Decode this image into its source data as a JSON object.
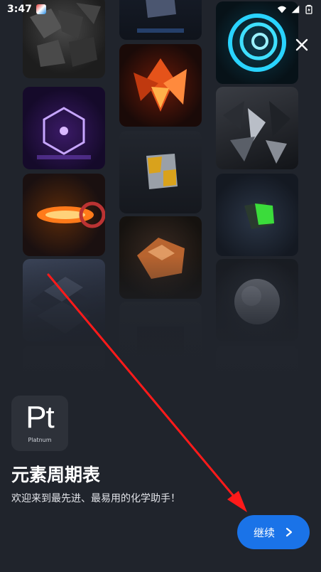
{
  "status_bar": {
    "time": "3:47"
  },
  "gallery": {
    "tiles": [
      "coal-rocks",
      "iron-cube",
      "blue-spiral",
      "purple-hexagon",
      "orange-crystals",
      "dark-crystals",
      "glowing-coil",
      "gold-dice",
      "green-cube",
      "metal-blocks",
      "copper-nugget",
      "grey-sphere",
      "dark-blocks"
    ]
  },
  "logo": {
    "symbol": "Pt",
    "name": "Platnum"
  },
  "title": "元素周期表",
  "subtitle": "欢迎来到最先进、最易用的化学助手！",
  "continue_button": {
    "label": "继续"
  },
  "colors": {
    "accent": "#1a73e8",
    "background": "#20242c",
    "annotation_arrow": "#ff1a1a"
  }
}
